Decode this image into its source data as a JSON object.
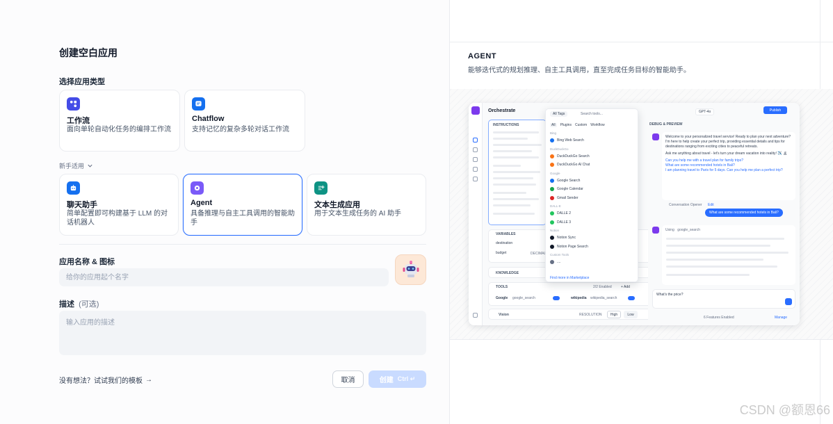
{
  "dialog": {
    "title": "创建空白应用",
    "app_type_label": "选择应用类型",
    "beginner_label": "新手适用",
    "name_label": "应用名称 & 图标",
    "name_placeholder": "给你的应用起个名字",
    "desc_label": "描述",
    "desc_optional": "(可选)",
    "desc_placeholder": "输入应用的描述",
    "template_link": "没有想法？试试我们的模板",
    "cancel_label": "取消",
    "create_label": "创建",
    "create_shortcut": "Ctrl ↵"
  },
  "app_types": [
    {
      "title": "工作流",
      "desc": "面向单轮自动化任务的编排工作流",
      "icon": "workflow-icon",
      "color": "#444ce7"
    },
    {
      "title": "Chatflow",
      "desc": "支持记忆的复杂多轮对话工作流",
      "icon": "chatflow-icon",
      "color": "#1570ef"
    }
  ],
  "beginner_types": [
    {
      "title": "聊天助手",
      "desc": "简单配置即可构建基于 LLM 的对话机器人",
      "icon": "chat-assistant-icon",
      "color": "#1570ef"
    },
    {
      "title": "Agent",
      "desc": "具备推理与自主工具调用的智能助手",
      "icon": "agent-icon",
      "color": "#7a5af8",
      "selected": true
    },
    {
      "title": "文本生成应用",
      "desc": "用于文本生成任务的 AI 助手",
      "icon": "text-generator-icon",
      "color": "#0e9384"
    }
  ],
  "preview": {
    "title": "AGENT",
    "desc": "能够迭代式的规划推理、自主工具调用，直至完成任务目标的智能助手。",
    "mock": {
      "orchestrate": "Orchestrate",
      "instructions": "INSTRUCTIONS",
      "variables": "VARIABLES",
      "var1": "destination",
      "var2": "budget",
      "var2_tag": "DECIMAL",
      "knowledge": "KNOWLEDGE",
      "tools": "TOOLS",
      "tools_count": "2/2 Enabled",
      "tools_add": "+ Add",
      "tool1": "Google",
      "tool1_sub": "google_search",
      "tool2": "wikipedia",
      "tool2_sub": "wikipedia_search",
      "vision": "Vision",
      "resolution": "RESOLUTION",
      "high": "High",
      "low": "Low",
      "model": "GPT-4o",
      "model_tag": "CHAT",
      "publish": "Publish",
      "debug": "DEBUG & PREVIEW",
      "search": "Search tools...",
      "all_tags": "All Tags",
      "filter_tabs": [
        "All",
        "Plugins",
        "Custom",
        "Workflow"
      ],
      "groups": [
        {
          "name": "Bing",
          "items": [
            "Bing Web Search"
          ]
        },
        {
          "name": "DuckDuckGo",
          "items": [
            "DuckDuckGo Search",
            "DuckDuckGo AI Chat"
          ]
        },
        {
          "name": "Google",
          "items": [
            "Google Search",
            "Google Calendar",
            "Gmail Sender"
          ]
        },
        {
          "name": "DALL-E",
          "items": [
            "DALLE 2",
            "DALLE 3"
          ]
        },
        {
          "name": "Notion",
          "items": [
            "Notion Sync",
            "Notion Page Search"
          ]
        },
        {
          "name": "Custom Tools",
          "items": [
            "...."
          ]
        }
      ],
      "marketplace": "Find more in Marketplace",
      "greeting1": "Welcome to your personalized travel service! Ready to plan your next adventure? I'm here to help create your perfect trip, providing essential details and tips for destinations ranging from exciting cities to peaceful retreats.",
      "greeting2": "Ask me anything about travel - let's turn your dream vacation into reality! ✈️ 🏝",
      "suggestion1": "Can you help me with a travel plan for family trips?",
      "suggestion2": "What are some recommended hotels in Bali?",
      "suggestion3": "I am planning travel to Paris for 5 days. Can you help me plan a perfect trip?",
      "opener": "Conversation Opener",
      "edit": "Edit",
      "user_msg": "What are some recommended hotels in Bali?",
      "using": "Using",
      "using_tool": "google_search",
      "input_text": "What's the price?",
      "features": "6 Features Enabled",
      "manage": "Manage"
    }
  },
  "watermark": "CSDN @额恩66"
}
